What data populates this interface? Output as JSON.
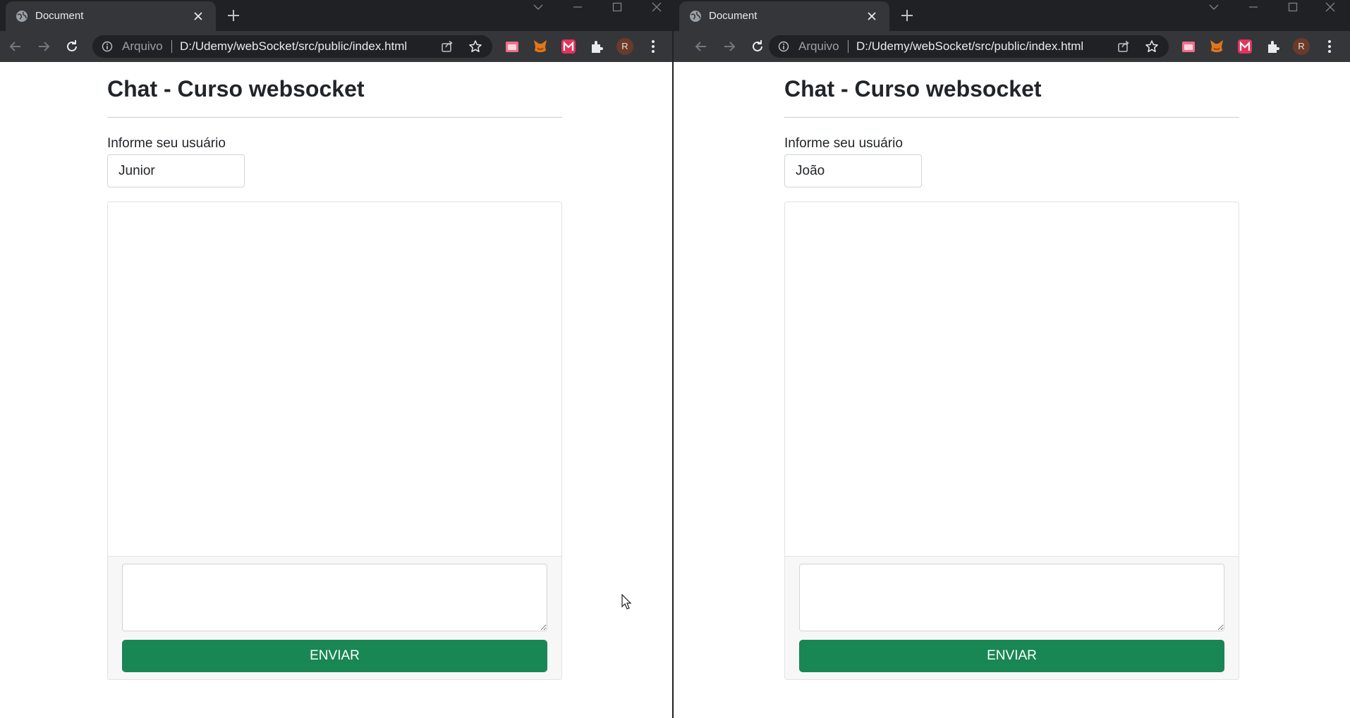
{
  "browser": {
    "tab_title": "Document",
    "address": {
      "scheme_label": "Arquivo",
      "url": "D:/Udemy/webSocket/src/public/index.html"
    },
    "profile_initial": "R",
    "colors": {
      "frame": "#202124",
      "toolbar": "#35363a",
      "omnibox": "#202124"
    },
    "icons": [
      "globe-icon",
      "close-icon",
      "plus-icon",
      "back-icon",
      "forward-icon",
      "reload-icon",
      "info-icon",
      "share-icon",
      "star-icon",
      "extension-icon",
      "kebab-menu-icon"
    ]
  },
  "windows": [
    {
      "id": "left",
      "page": {
        "title": "Chat - Curso websocket",
        "user_label": "Informe seu usuário",
        "username_value": "Junior",
        "message_value": "",
        "send_label": "ENVIAR"
      }
    },
    {
      "id": "right",
      "page": {
        "title": "Chat - Curso websocket",
        "user_label": "Informe seu usuário",
        "username_value": "João",
        "message_value": "",
        "send_label": "ENVIAR"
      }
    }
  ],
  "colors": {
    "send_button": "#198754",
    "text": "#212529"
  }
}
